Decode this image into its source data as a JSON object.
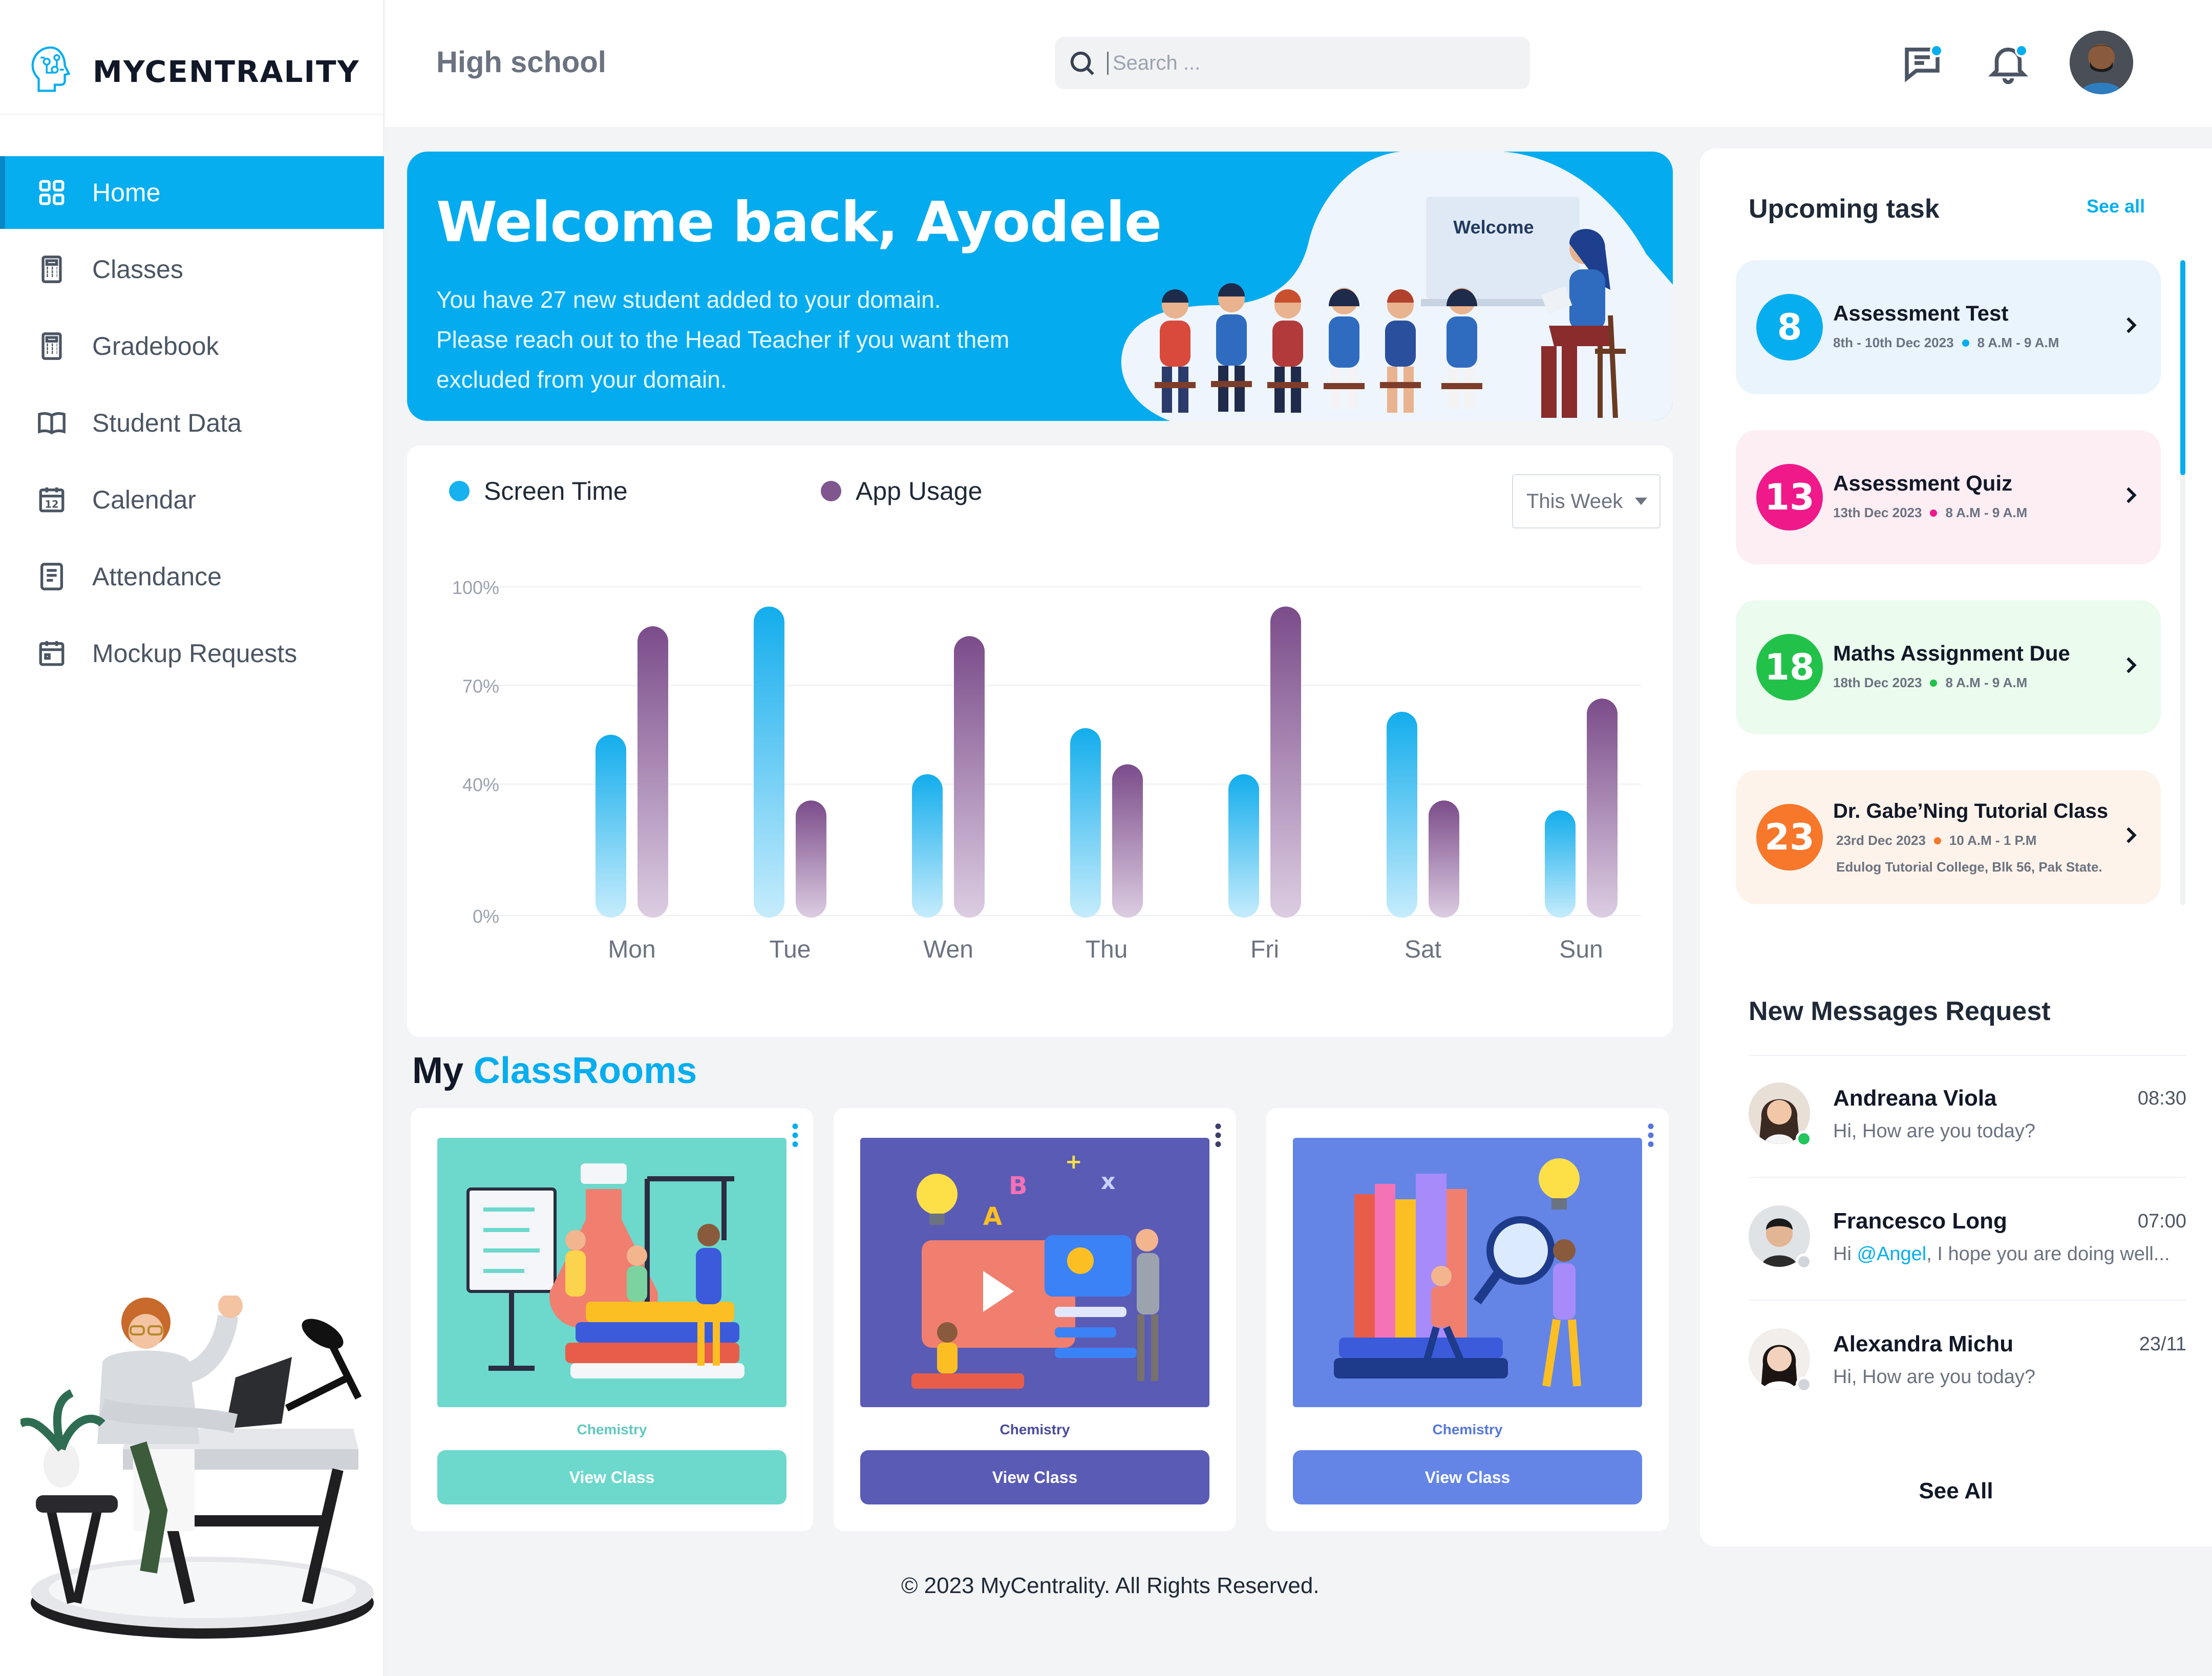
{
  "app": {
    "name": "MYCENTRALITY"
  },
  "sidebar": {
    "items": [
      {
        "label": "Home",
        "icon": "grid-icon",
        "active": true
      },
      {
        "label": "Classes",
        "icon": "calculator-icon"
      },
      {
        "label": "Gradebook",
        "icon": "calculator-icon"
      },
      {
        "label": "Student Data",
        "icon": "book-open-icon"
      },
      {
        "label": "Calendar",
        "icon": "calendar-icon",
        "badge": "12"
      },
      {
        "label": "Attendance",
        "icon": "document-icon"
      },
      {
        "label": "Mockup Requests",
        "icon": "calendar-icon"
      }
    ]
  },
  "header": {
    "title": "High school",
    "search_placeholder": "Search ...",
    "icons": [
      "messages-icon",
      "bell-icon",
      "avatar"
    ]
  },
  "banner": {
    "title": "Welcome back, Ayodele",
    "message_lines": [
      "You have 27 new student added to your domain.",
      "Please reach out to the Head Teacher if you want them",
      "excluded from your domain."
    ],
    "board_text": "Welcome"
  },
  "colors": {
    "accent": "#06aeef",
    "screen_time": "#16b1ee",
    "app_usage": "#80568f",
    "task_blue": "#06aeef",
    "task_pink": "#f0198a",
    "task_green": "#22c24a",
    "task_orange": "#f7772b"
  },
  "chart_data": {
    "type": "bar",
    "categories": [
      "Mon",
      "Tue",
      "Wen",
      "Thu",
      "Fri",
      "Sat",
      "Sun"
    ],
    "series": [
      {
        "name": "Screen Time",
        "values": [
          55,
          94,
          43,
          57,
          43,
          62,
          32
        ]
      },
      {
        "name": "App Usage",
        "values": [
          88,
          35,
          85,
          46,
          94,
          35,
          66
        ]
      }
    ],
    "yticks": [
      "100%",
      "70%",
      "40%",
      "0%"
    ],
    "ytick_values": [
      100,
      70,
      40,
      0
    ],
    "ylim": [
      0,
      100
    ],
    "period_select": "This Week",
    "legend_position": "top-left",
    "grid": true
  },
  "classrooms": {
    "title_prefix": "My",
    "title_accent": "ClassRooms",
    "cards": [
      {
        "subject": "Chemistry",
        "button": "View Class",
        "color": "#6dd8cc",
        "subject_color": "#5fc9bd"
      },
      {
        "subject": "Chemistry",
        "button": "View Class",
        "color": "#5a5bb5",
        "subject_color": "#4a4a9c"
      },
      {
        "subject": "Chemistry",
        "button": "View Class",
        "color": "#6485e6",
        "subject_color": "#5577dd"
      }
    ]
  },
  "footer": {
    "text": "© 2023 MyCentrality. All Rights Reserved."
  },
  "upcoming": {
    "title": "Upcoming task",
    "see_all": "See all",
    "tasks": [
      {
        "day": "8",
        "name": "Assessment Test",
        "date": "8th - 10th Dec 2023",
        "time": "8 A.M - 9 A.M",
        "location": ""
      },
      {
        "day": "13",
        "name": "Assessment Quiz",
        "date": "13th Dec 2023",
        "time": "8 A.M - 9 A.M",
        "location": ""
      },
      {
        "day": "18",
        "name": "Maths Assignment Due",
        "date": "18th Dec 2023",
        "time": "8 A.M - 9 A.M",
        "location": ""
      },
      {
        "day": "23",
        "name": "Dr. Gabe’Ning Tutorial Class",
        "date": "23rd Dec 2023",
        "time": "10 A.M - 1 P.M",
        "location": "Edulog Tutorial College, Blk 56, Pak State."
      }
    ]
  },
  "messages": {
    "title": "New Messages Request",
    "see_all": "See All",
    "items": [
      {
        "name": "Andreana Viola",
        "time": "08:30",
        "text": "Hi, How are you today?",
        "mention": "",
        "rest": "",
        "online": true
      },
      {
        "name": "Francesco Long",
        "time": "07:00",
        "text": "Hi ",
        "mention": "@Angel",
        "rest": ", I hope you are doing well...",
        "online": false
      },
      {
        "name": "Alexandra Michu",
        "time": "23/11",
        "text": "Hi, How are you today?",
        "mention": "",
        "rest": "",
        "online": false
      }
    ]
  }
}
